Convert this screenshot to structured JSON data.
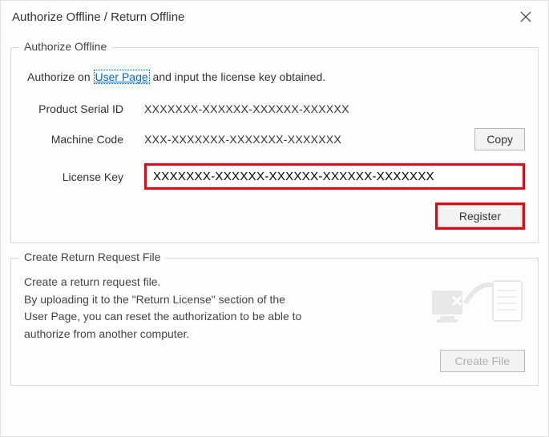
{
  "titlebar": {
    "title": "Authorize Offline / Return Offline"
  },
  "authorize": {
    "group_label": "Authorize Offline",
    "intro_prefix": "Authorize on ",
    "user_page_link": "User Page",
    "intro_suffix": " and input the license key obtained.",
    "serial_label": "Product Serial ID",
    "serial_value": "XXXXXXX-XXXXXX-XXXXXX-XXXXXX",
    "machine_label": "Machine Code",
    "machine_value": "XXX-XXXXXXX-XXXXXXX-XXXXXXX",
    "copy_label": "Copy",
    "license_label": "License Key",
    "license_value": "XXXXXXX-XXXXXX-XXXXXX-XXXXXX-XXXXXXX",
    "register_label": "Register"
  },
  "return": {
    "group_label": "Create Return Request File",
    "line1": "Create a return request file.",
    "line2": "By uploading it to the \"Return License\" section of the",
    "line3": "User Page, you can reset the authorization to be able to",
    "line4": "authorize from another computer.",
    "create_label": "Create File"
  }
}
